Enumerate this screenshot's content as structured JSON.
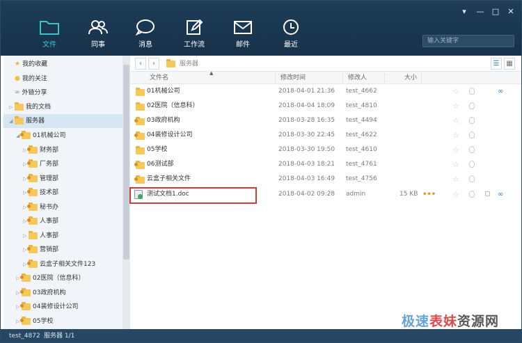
{
  "window": {
    "minimize": "▾",
    "minus": "—",
    "maximize": "□",
    "close": "✕"
  },
  "nav": [
    {
      "label": "文件",
      "icon": "folder-icon",
      "active": true
    },
    {
      "label": "同事",
      "icon": "colleagues-icon",
      "active": false
    },
    {
      "label": "消息",
      "icon": "chat-icon",
      "active": false
    },
    {
      "label": "工作流",
      "icon": "workflow-icon",
      "active": false
    },
    {
      "label": "邮件",
      "icon": "mail-icon",
      "active": false
    },
    {
      "label": "最近",
      "icon": "clock-icon",
      "active": false
    }
  ],
  "search": {
    "placeholder": "输入关键字"
  },
  "sidebar": {
    "items": [
      {
        "label": "我的收藏",
        "icon": "star-icon",
        "level": 0
      },
      {
        "label": "我的关注",
        "icon": "bulb-icon",
        "level": 0
      },
      {
        "label": "外链分享",
        "icon": "link-icon",
        "level": 0
      },
      {
        "label": "我的文档",
        "icon": "folder-icon",
        "level": 0
      },
      {
        "label": "服务器",
        "icon": "folder-icon",
        "level": 0
      },
      {
        "label": "01机械公司",
        "icon": "shared-folder-icon",
        "level": 1
      },
      {
        "label": "财务部",
        "icon": "shared-folder-icon",
        "level": 2
      },
      {
        "label": "厂务部",
        "icon": "shared-folder-icon",
        "level": 2
      },
      {
        "label": "管理部",
        "icon": "shared-folder-icon",
        "level": 2
      },
      {
        "label": "技术部",
        "icon": "shared-folder-icon",
        "level": 2
      },
      {
        "label": "秘书办",
        "icon": "shared-folder-icon",
        "level": 2
      },
      {
        "label": "人事部",
        "icon": "shared-folder-icon",
        "level": 2
      },
      {
        "label": "人事部",
        "icon": "folder-icon",
        "level": 2
      },
      {
        "label": "营销部",
        "icon": "shared-folder-icon",
        "level": 2
      },
      {
        "label": "云盒子相关文件123",
        "icon": "shared-folder-icon",
        "level": 2
      },
      {
        "label": "02医院（信息科）",
        "icon": "shared-folder-icon",
        "level": 1
      },
      {
        "label": "03政府机构",
        "icon": "shared-folder-icon",
        "level": 1
      },
      {
        "label": "04装修设计公司",
        "icon": "shared-folder-icon",
        "level": 1
      },
      {
        "label": "05学校",
        "icon": "shared-folder-icon",
        "level": 1
      }
    ]
  },
  "toolbar": {
    "back": "‹",
    "forward": "›",
    "breadcrumb": "服务器"
  },
  "columns": {
    "name": "文件名",
    "modified": "修改时间",
    "modifier": "修改人",
    "size": "大小"
  },
  "files": [
    {
      "name": "01机械公司",
      "time": "2018-04-01 21:36",
      "user": "test_4662",
      "size": "",
      "shared": false,
      "link": true
    },
    {
      "name": "02医院（信息科）",
      "time": "2018-04-04 18:09",
      "user": "test_4810",
      "size": "",
      "shared": false,
      "link": false
    },
    {
      "name": "03政府机构",
      "time": "2018-03-28 16:35",
      "user": "test_4494",
      "size": "",
      "shared": true,
      "link": false
    },
    {
      "name": "04装修设计公司",
      "time": "2018-03-30 22:45",
      "user": "test_4622",
      "size": "",
      "shared": true,
      "link": false
    },
    {
      "name": "05学校",
      "time": "2018-03-30 19:50",
      "user": "test_4610",
      "size": "",
      "shared": false,
      "link": false
    },
    {
      "name": "06测试部",
      "time": "2018-04-03 18:21",
      "user": "test_4761",
      "size": "",
      "shared": true,
      "link": false
    },
    {
      "name": "云盒子相关文件",
      "time": "2018-04-03 16:49",
      "user": "test_4756",
      "size": "",
      "shared": true,
      "link": false
    },
    {
      "name": "测试文档1.doc",
      "time": "2018-04-02 09:28",
      "user": "admin",
      "size": "15 KB",
      "doc": true,
      "link": true
    }
  ],
  "status": {
    "user": "test_4872",
    "server": "服务器 1/1"
  },
  "watermark": {
    "a": "极速",
    "b": "表妹",
    "c": "资源网"
  }
}
